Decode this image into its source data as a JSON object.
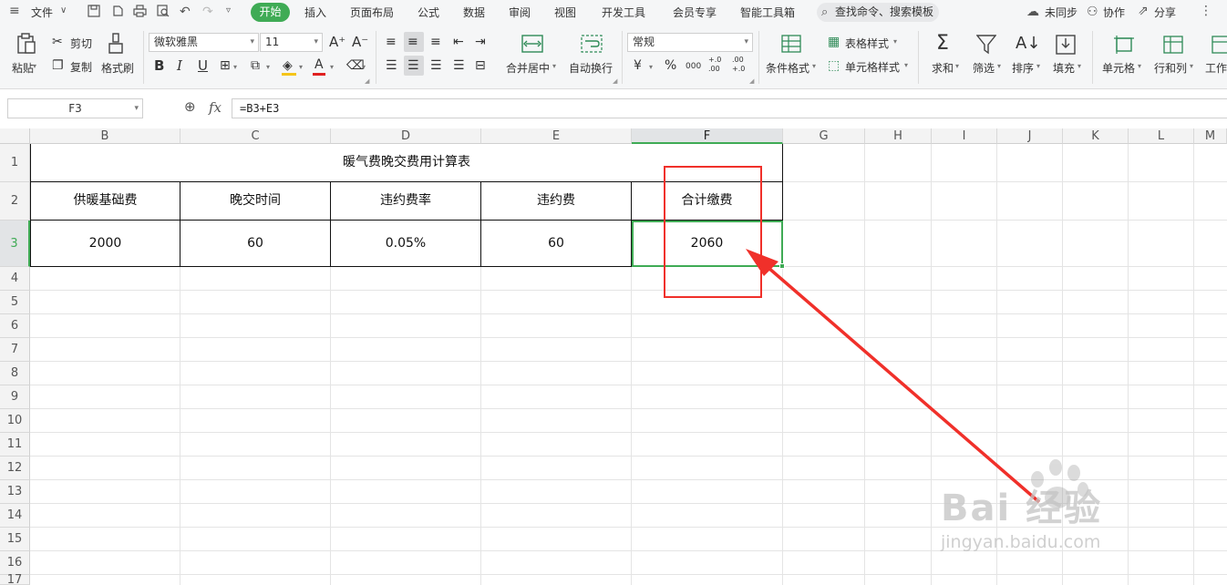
{
  "menubar": {
    "file_label": "文件",
    "tabs": [
      "开始",
      "插入",
      "页面布局",
      "公式",
      "数据",
      "审阅",
      "视图",
      "开发工具",
      "会员专享",
      "智能工具箱"
    ],
    "search_placeholder": "查找命令、搜索模板",
    "sync_label": "未同步",
    "collab_label": "协作",
    "share_label": "分享"
  },
  "ribbon": {
    "paste": "粘贴",
    "cut": "剪切",
    "copy": "复制",
    "format_painter": "格式刷",
    "font_name": "微软雅黑",
    "font_size": "11",
    "bold": "B",
    "italic": "I",
    "underline": "U",
    "merge_center": "合并居中",
    "wrap_text": "自动换行",
    "number_format": "常规",
    "currency": "¥",
    "percent": "%",
    "thousands": "000",
    "inc_decimal": "+.0 .00",
    "dec_decimal": ".00 +.0",
    "conditional_format": "条件格式",
    "table_style": "表格样式",
    "cell_style": "单元格样式",
    "sum": "求和",
    "filter": "筛选",
    "sort": "排序",
    "fill": "填充",
    "cell": "单元格",
    "row_col": "行和列",
    "worksheet": "工作"
  },
  "formula_bar": {
    "name_box": "F3",
    "fx": "fx",
    "formula": "=B3+E3"
  },
  "sheet": {
    "columns": [
      "B",
      "C",
      "D",
      "E",
      "F",
      "G",
      "H",
      "I",
      "J",
      "K",
      "L",
      "M"
    ],
    "rows": [
      "1",
      "2",
      "3",
      "4",
      "5",
      "6",
      "7",
      "8",
      "9",
      "10",
      "11",
      "12",
      "13",
      "14",
      "15",
      "16",
      "17"
    ],
    "title": "暖气费晚交费用计算表",
    "headers": [
      "供暖基础费",
      "晚交时间",
      "违约费率",
      "违约费",
      "合计缴费"
    ],
    "values": [
      "2000",
      "60",
      "0.05%",
      "60",
      "2060"
    ]
  },
  "watermark": {
    "brand": "Bai 经验",
    "url": "jingyan.baidu.com"
  },
  "colors": {
    "accent_green": "#3fab55",
    "annotation_red": "#f0302a"
  }
}
